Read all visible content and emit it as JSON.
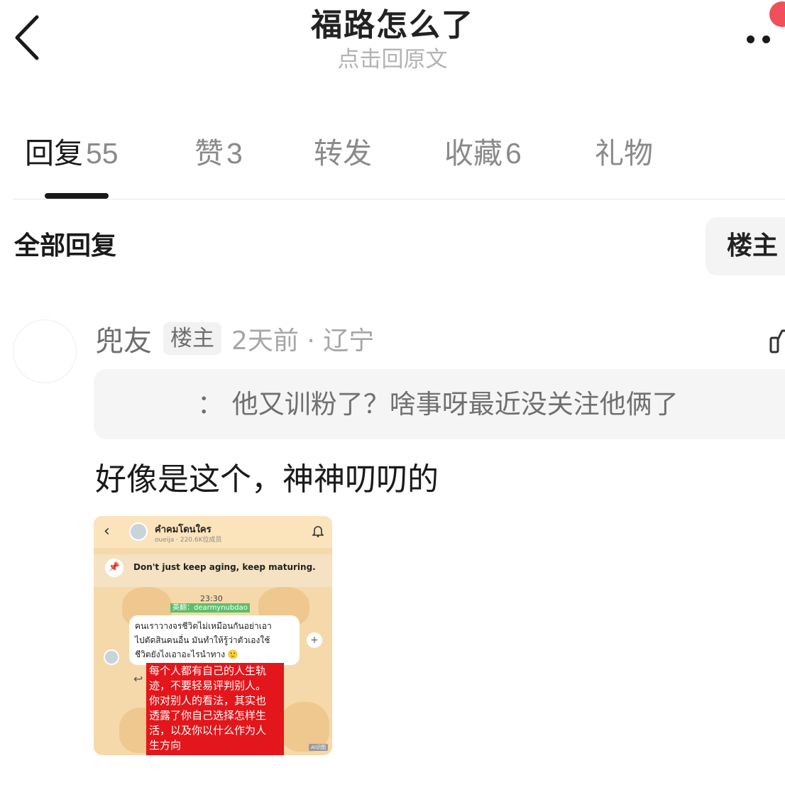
{
  "header": {
    "title": "福路怎么了",
    "subtitle": "点击回原文"
  },
  "tabs": [
    {
      "label": "回复",
      "count": "55",
      "active": true
    },
    {
      "label": "赞",
      "count": "3"
    },
    {
      "label": "转发",
      "count": ""
    },
    {
      "label": "收藏",
      "count": "6"
    },
    {
      "label": "礼物",
      "count": ""
    }
  ],
  "filter": {
    "label": "全部回复",
    "toggle_label": "楼主"
  },
  "comment": {
    "username": "兜友",
    "badge": "楼主",
    "meta": "2天前 · 辽宁",
    "quote": "： 他又训粉了？啥事呀最近没关注他俩了",
    "text": "好像是这个，神神叨叨的",
    "embed": {
      "channel_name": "คำคมโดนใคร",
      "channel_sub": "oueija · 220.6K位成员",
      "pinned": "Don't just keep aging, keep maturing.",
      "time": "23:30",
      "translate_tag": "英翻：dearmynubdao",
      "message_lines": [
        "คนเราวางจรชีวิตไม่เหมือนกันอย่าเอา",
        "ไปตัดสินคนอื่น มันทำให้รู้ว่าตัวเองใช้",
        "ชีวิตยังไงเอาอะไรนำทาง 🙂"
      ],
      "red_lines": [
        "每个人都有自己的人生轨",
        "迹，不要轻易评判别人。",
        "你对别人的看法，其实也",
        "透露了你自己选择怎样生",
        "活，以及你以什么作为人",
        "生方向"
      ],
      "watermark": "AI识图"
    }
  },
  "colors": {
    "text_primary": "#1a1a1a",
    "text_secondary": "#8a8a8a",
    "badge_bg": "#f2f2f2",
    "quote_bg": "#f5f5f5",
    "notification_red": "#f0505a",
    "highlight_red": "#e3161b"
  },
  "icons": {
    "back": "chevron-left-icon",
    "more": "more-dots-icon",
    "like": "thumbs-up-icon"
  }
}
